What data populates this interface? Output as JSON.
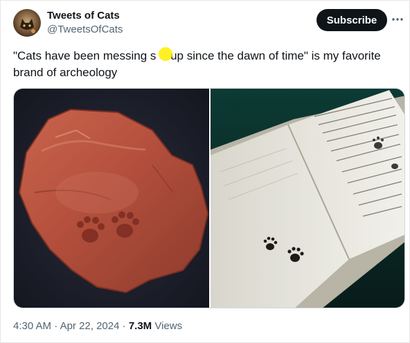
{
  "author": {
    "display_name": "Tweets of Cats",
    "handle": "@TweetsOfCats",
    "avatar_icon": "cat-avatar-icon"
  },
  "header": {
    "subscribe_label": "Subscribe",
    "more_icon": "more-horizontal-icon"
  },
  "tweet": {
    "text_part1": "\"Cats have been messing s",
    "text_part2": " up since the dawn of time\" is my favorite brand of archeology"
  },
  "media": {
    "photos": [
      {
        "name": "roman-tile-with-cat-paw-prints",
        "background": "#1b1e2a"
      },
      {
        "name": "medieval-manuscript-with-cat-paw-prints",
        "background": "#0e2e2a"
      }
    ]
  },
  "footer": {
    "time": "4:30 AM",
    "separator": "·",
    "date": "Apr 22, 2024",
    "views_count": "7.3M",
    "views_label": "Views"
  },
  "colors": {
    "text_primary": "#0f1419",
    "text_secondary": "#536471",
    "button_bg": "#0f1419",
    "cursor_highlight": "#ffee00"
  }
}
